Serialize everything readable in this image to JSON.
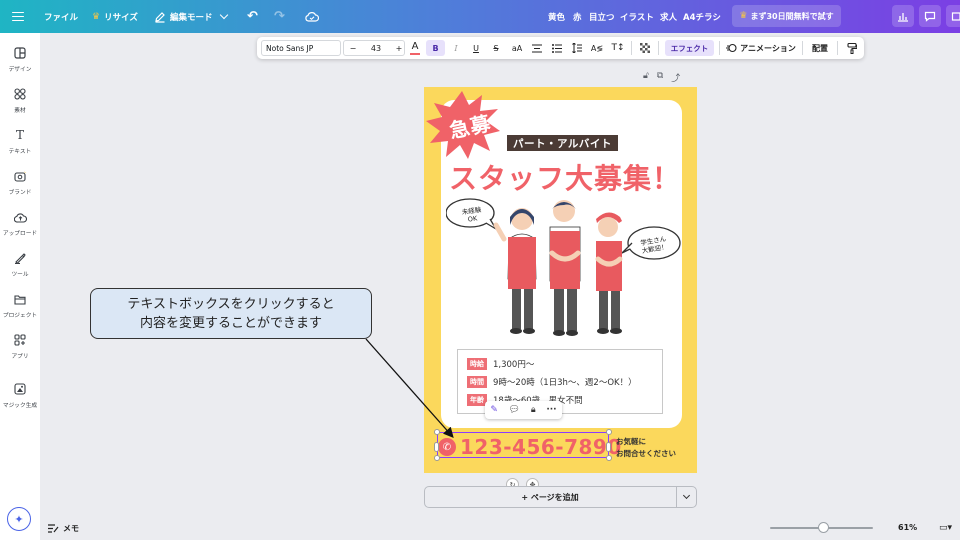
{
  "topbar": {
    "file_label": "ファイル",
    "resize_label": "リサイズ",
    "edit_mode_label": "編集モード",
    "tags": [
      "黄色",
      "赤",
      "目立つ",
      "イラスト",
      "求人",
      "A4チラシ"
    ],
    "trial_label": "まず30日間無料で試す"
  },
  "sidebar": {
    "items": [
      {
        "label": "デザイン",
        "icon": "design-icon"
      },
      {
        "label": "素材",
        "icon": "elements-icon"
      },
      {
        "label": "テキスト",
        "icon": "text-icon"
      },
      {
        "label": "ブランド",
        "icon": "brand-icon"
      },
      {
        "label": "アップロード",
        "icon": "upload-icon"
      },
      {
        "label": "ツール",
        "icon": "tools-icon"
      },
      {
        "label": "プロジェクト",
        "icon": "folder-icon"
      },
      {
        "label": "アプリ",
        "icon": "apps-icon"
      },
      {
        "label": "マジック生成",
        "icon": "magic-icon"
      }
    ]
  },
  "text_toolbar": {
    "font": "Noto Sans JP",
    "size": "43",
    "effect_label": "エフェクト",
    "animation_label": "アニメーション",
    "position_label": "配置"
  },
  "flyer": {
    "burst_text": "急募",
    "badge_text": "パート・アルバイト",
    "headline": "スタッフ大募集！",
    "bubble_left": "未経験\nOK",
    "bubble_right": "学生さん\n大歓迎！",
    "info": [
      {
        "label": "時給",
        "value": "1,300円〜"
      },
      {
        "label": "時間",
        "value": "9時〜20時（1日3h〜、週2〜OK！）"
      },
      {
        "label": "年齢",
        "value": "18歳〜60歳　男女不問"
      }
    ],
    "phone": "123-456-7890",
    "contact_line1": "お気軽に",
    "contact_line2": "お問合せください"
  },
  "callout": {
    "line1": "テキストボックスをクリックすると",
    "line2": "内容を変更することができます"
  },
  "add_page_label": "+ ページを追加",
  "bottom": {
    "memo_label": "メモ",
    "zoom": "61%"
  },
  "colors": {
    "accent": "#8b3dff",
    "flyer_bg": "#fbd85c",
    "flyer_red": "#f06268",
    "callout_bg": "#dbe7f5"
  }
}
